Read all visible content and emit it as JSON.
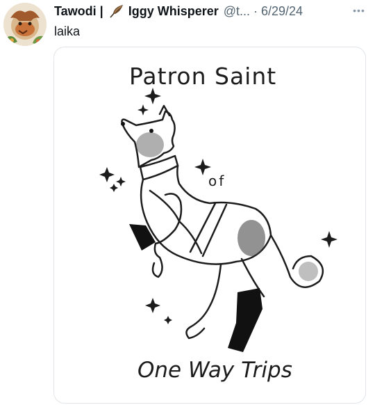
{
  "tweet": {
    "author_name": "Tawodi |",
    "author_badge": "Iggy Whisperer",
    "handle": "@t...",
    "separator": "·",
    "date": "6/29/24",
    "more_label": "•••",
    "text": "laika"
  },
  "media": {
    "title": "Patron Saint",
    "connector": "of",
    "subtitle": "One Way Trips"
  },
  "icons": {
    "feather": "feather-icon",
    "more": "more-options-icon"
  },
  "colors": {
    "text_primary": "#0f1419",
    "text_secondary": "#536471",
    "border": "#e1e5e9"
  }
}
